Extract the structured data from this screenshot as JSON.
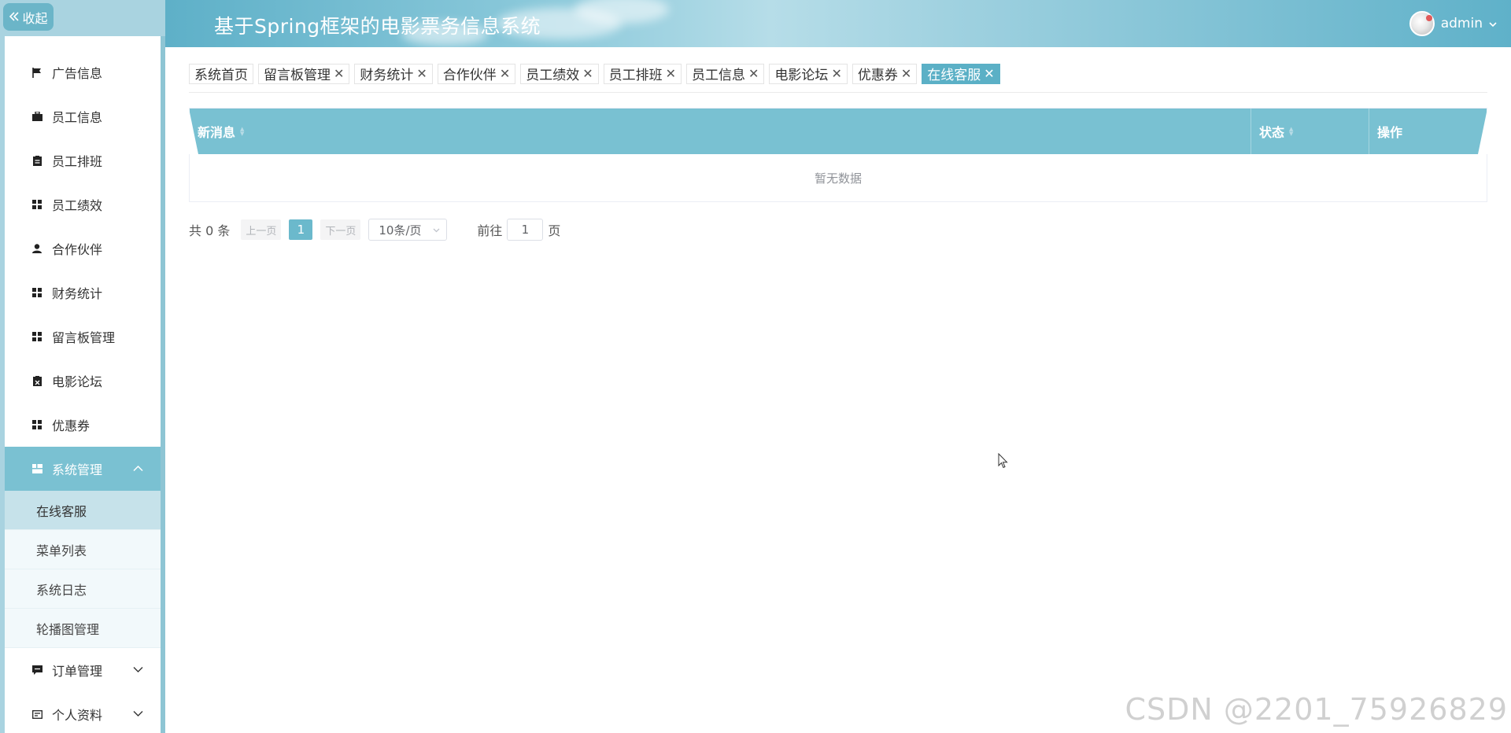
{
  "sidebar": {
    "collapse_label": "收起",
    "menu": [
      {
        "label": "广告信息",
        "icon": "flag-icon"
      },
      {
        "label": "员工信息",
        "icon": "briefcase-icon"
      },
      {
        "label": "员工排班",
        "icon": "clipboard-icon"
      },
      {
        "label": "员工绩效",
        "icon": "grid-icon"
      },
      {
        "label": "合作伙伴",
        "icon": "user-icon"
      },
      {
        "label": "财务统计",
        "icon": "grid-icon"
      },
      {
        "label": "留言板管理",
        "icon": "grid-icon"
      },
      {
        "label": "电影论坛",
        "icon": "clipboard-x-icon"
      },
      {
        "label": "优惠券",
        "icon": "grid-icon"
      },
      {
        "label": "系统管理",
        "icon": "dashboard-icon"
      }
    ],
    "submenu": [
      "在线客服",
      "菜单列表",
      "系统日志",
      "轮播图管理"
    ],
    "menu_bottom": [
      {
        "label": "订单管理",
        "icon": "chat-icon"
      },
      {
        "label": "个人资料",
        "icon": "id-card-icon"
      }
    ]
  },
  "header": {
    "title": "基于Spring框架的电影票务信息系统",
    "username": "admin"
  },
  "tags": [
    "系统首页",
    "留言板管理",
    "财务统计",
    "合作伙伴",
    "员工绩效",
    "员工排班",
    "员工信息",
    "电影论坛",
    "优惠券",
    "在线客服"
  ],
  "table": {
    "columns": [
      "新消息",
      "状态",
      "操作"
    ],
    "empty_text": "暂无数据"
  },
  "pagination": {
    "total": "共 0 条",
    "prev": "上一页",
    "current_page": "1",
    "next": "下一页",
    "page_size": "10条/页",
    "goto_label": "前往",
    "goto_value": "1",
    "goto_suffix": "页"
  },
  "watermark": "CSDN @2201_75926829",
  "colors": {
    "primary": "#79c1d2",
    "active_tag": "#5bb0c6",
    "sidebar_bg": "#a9d3e0"
  }
}
